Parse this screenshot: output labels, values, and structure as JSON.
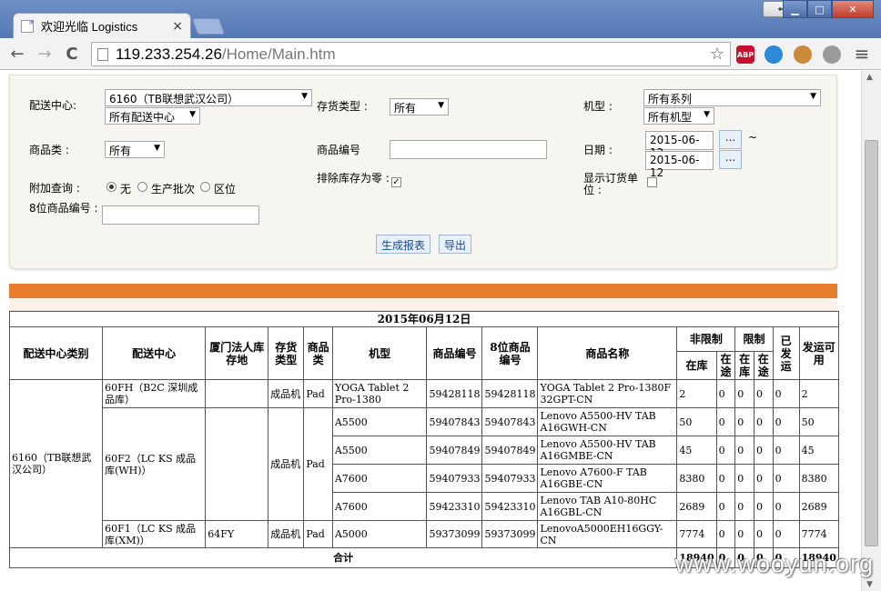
{
  "browser": {
    "tab_title": "欢迎光临 Logistics",
    "tab_close": "×",
    "url_host": "119.233.254.26",
    "url_path": "/Home/Main.htm",
    "back": "←",
    "forward": "→",
    "reload": "C",
    "star": "☆",
    "menu": "≡",
    "win_min": "▁",
    "win_max": "□",
    "win_close": "✕",
    "win_restore": "⇔",
    "ext_abp": "ABP"
  },
  "filter": {
    "dc_label": "配送中心:",
    "dc_value": "6160（TB联想武汉公司）",
    "dc_sub_value": "所有配送中心",
    "stock_type_label": "存货类型 :",
    "stock_type_value": "所有",
    "model_label": "机型 :",
    "series_value": "所有系列",
    "model_value": "所有机型",
    "category_label": "商品类 :",
    "category_value": "所有",
    "product_code_label": "商品编号",
    "product_code_value": "",
    "date_label": "日期 :",
    "date_from": "2015-06-12",
    "date_to": "2015-06-12",
    "date_pick": "...",
    "date_sep": "~",
    "extra_query_label": "附加查询 :",
    "radio_none": "无",
    "radio_batch": "生产批次",
    "radio_location": "区位",
    "exclude_zero_label": "排除库存为零 :",
    "show_order_unit_label": "显示订货单位 :",
    "code8_label": "8位商品编号 :",
    "code8_value": "",
    "generate_button": "生成报表",
    "export_button": "导出"
  },
  "report": {
    "date_title": "2015年06月12日",
    "headers": {
      "dc_category": "配送中心类别",
      "dc": "配送中心",
      "xiamen_loc": "厦门法人库存地",
      "stock_type": "存货类型",
      "category": "商品类",
      "model": "机型",
      "product_code": "商品编号",
      "code8": "8位商品编号",
      "product_name": "商品名称",
      "unrestricted": "非限制",
      "restricted": "限制",
      "shipped": "已发运",
      "available": "发运可用",
      "in_stock": "在库",
      "in_transit": "在途"
    },
    "dc_category_value": "6160（TB联想武汉公司）",
    "groups": [
      {
        "dc": "60FH（B2C 深圳成品库）",
        "loc": "",
        "type": "成品机",
        "cat": "Pad",
        "rows": [
          {
            "model": "YOGA Tablet 2 Pro-1380",
            "code": "59428118",
            "code8": "59428118",
            "name": "YOGA Tablet 2 Pro-1380F 32GPT-CN",
            "u_stock": "2",
            "u_transit": "0",
            "r_stock": "0",
            "r_transit": "0",
            "shipped": "0",
            "available": "2"
          }
        ]
      },
      {
        "dc": "60F2（LC KS 成品库(WH)）",
        "loc": "",
        "type": "成品机",
        "cat": "Pad",
        "rows": [
          {
            "model": "A5500",
            "code": "59407843",
            "code8": "59407843",
            "name": "Lenovo A5500-HV TAB A16GWH-CN",
            "u_stock": "50",
            "u_transit": "0",
            "r_stock": "0",
            "r_transit": "0",
            "shipped": "0",
            "available": "50"
          },
          {
            "model": "A5500",
            "code": "59407849",
            "code8": "59407849",
            "name": "Lenovo A5500-HV TAB A16GMBE-CN",
            "u_stock": "45",
            "u_transit": "0",
            "r_stock": "0",
            "r_transit": "0",
            "shipped": "0",
            "available": "45"
          },
          {
            "model": "A7600",
            "code": "59407933",
            "code8": "59407933",
            "name": "Lenovo A7600-F TAB A16GBE-CN",
            "u_stock": "8380",
            "u_transit": "0",
            "r_stock": "0",
            "r_transit": "0",
            "shipped": "0",
            "available": "8380"
          },
          {
            "model": "A7600",
            "code": "59423310",
            "code8": "59423310",
            "name": "Lenovo TAB A10-80HC A16GBL-CN",
            "u_stock": "2689",
            "u_transit": "0",
            "r_stock": "0",
            "r_transit": "0",
            "shipped": "0",
            "available": "2689"
          }
        ]
      },
      {
        "dc": "60F1（LC KS 成品库(XM)）",
        "loc": "64FY",
        "type": "成品机",
        "cat": "Pad",
        "rows": [
          {
            "model": "A5000",
            "code": "59373099",
            "code8": "59373099",
            "name": "LenovoA5000EH16GGY-CN",
            "u_stock": "7774",
            "u_transit": "0",
            "r_stock": "0",
            "r_transit": "0",
            "shipped": "0",
            "available": "7774"
          }
        ]
      }
    ],
    "total_label": "合计",
    "total": {
      "u_stock": "18940",
      "u_transit": "0",
      "r_stock": "0",
      "r_transit": "0",
      "shipped": "0",
      "available": "18940"
    }
  },
  "watermark": "www.wooyun.org"
}
